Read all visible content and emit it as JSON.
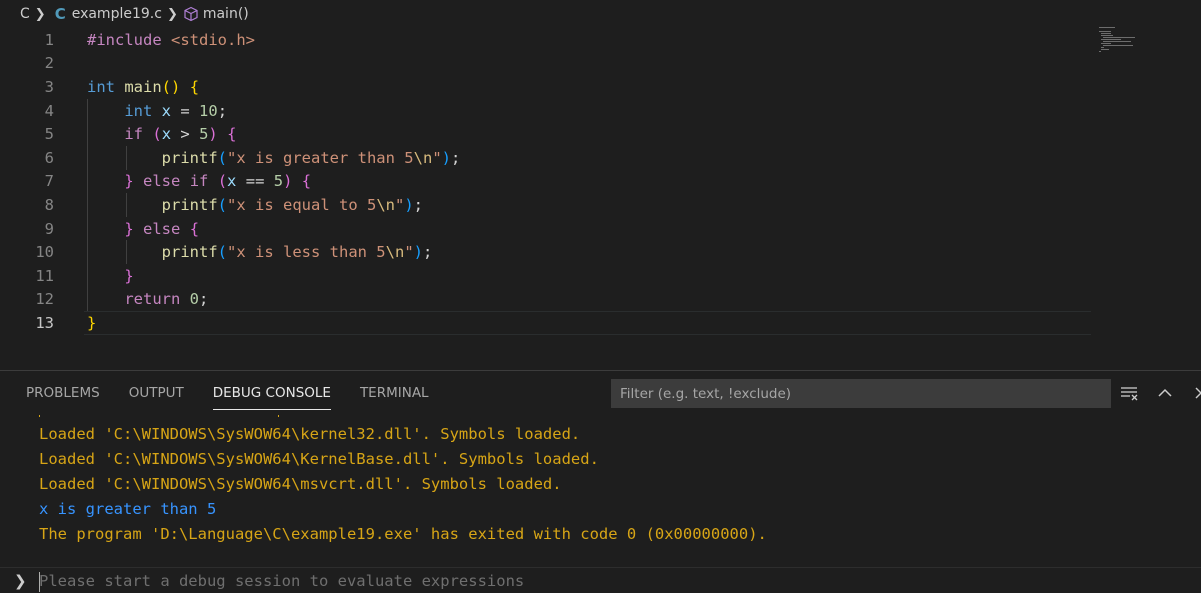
{
  "breadcrumb": {
    "folder": "C",
    "file_icon": "C",
    "file": "example19.c",
    "symbol": "main()"
  },
  "editor": {
    "line_numbers": [
      "1",
      "2",
      "3",
      "4",
      "5",
      "6",
      "7",
      "8",
      "9",
      "10",
      "11",
      "12",
      "13"
    ],
    "active_line": "13"
  },
  "panel": {
    "tabs": [
      "PROBLEMS",
      "OUTPUT",
      "DEBUG CONSOLE",
      "TERMINAL"
    ],
    "active_tab": "DEBUG CONSOLE",
    "filter_placeholder": "Filter (e.g. text, !exclude)"
  },
  "console": {
    "lines": [
      {
        "text": "Loaded 'C:\\WINDOWS\\SysWOW64\\kernel32.dll'. Symbols loaded.",
        "color": "#d7a516"
      },
      {
        "text": "Loaded 'C:\\WINDOWS\\SysWOW64\\KernelBase.dll'. Symbols loaded.",
        "color": "#d7a516"
      },
      {
        "text": "Loaded 'C:\\WINDOWS\\SysWOW64\\msvcrt.dll'. Symbols loaded.",
        "color": "#d7a516"
      },
      {
        "text": "x is greater than 5",
        "color": "#3794ff"
      },
      {
        "text": "The program 'D:\\Language\\C\\example19.exe' has exited with code 0 (0x00000000).",
        "color": "#d7a516"
      }
    ],
    "repl_placeholder": "Please start a debug session to evaluate expressions"
  },
  "icons": {
    "breadcrumb_separator": "chevron-right-icon",
    "symbol": "cube-icon",
    "filter_toggle": "clear-filter-icon",
    "maximize": "chevron-up-icon",
    "close": "close-icon",
    "repl_prompt": "chevron-right-icon"
  }
}
